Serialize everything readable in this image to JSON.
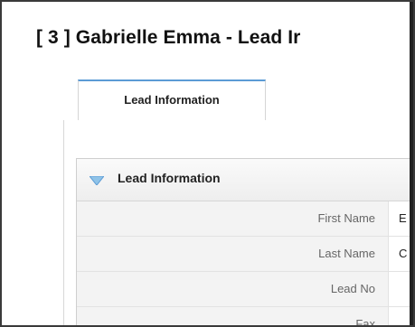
{
  "page": {
    "title": "[ 3 ] Gabrielle Emma - Lead Ir"
  },
  "tabs": [
    {
      "label": "Lead Information",
      "active": true
    }
  ],
  "section": {
    "title": "Lead Information",
    "icon": "triangle-down-icon",
    "icon_color": "#8fc3e8"
  },
  "fields": [
    {
      "label": "First Name",
      "value": "E"
    },
    {
      "label": "Last Name",
      "value": "C"
    },
    {
      "label": "Lead No",
      "value": ""
    },
    {
      "label": "Fax",
      "value": ""
    }
  ],
  "colors": {
    "tab_accent": "#5b9bd5",
    "label_bg": "#f3f3f3"
  }
}
